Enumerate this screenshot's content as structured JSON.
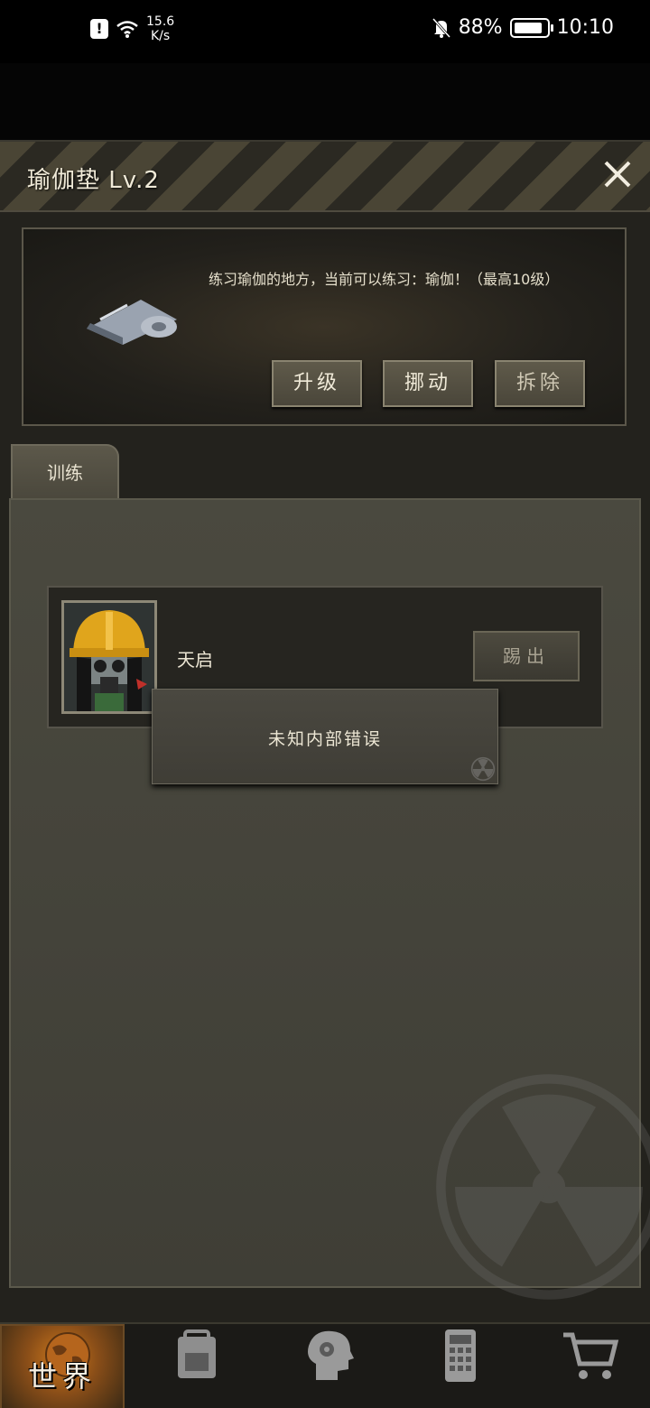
{
  "status_bar": {
    "network_speed_value": "15.6",
    "network_speed_unit": "K/s",
    "battery": "88%",
    "time": "10:10"
  },
  "dialog": {
    "title": "瑜伽垫 Lv.2",
    "description": "练习瑜伽的地方，当前可以练习：瑜伽！（最高10级）",
    "buttons": {
      "upgrade": "升级",
      "move": "挪动",
      "remove": "拆除"
    }
  },
  "tabs": [
    {
      "label": "训练",
      "selected": true
    }
  ],
  "members": [
    {
      "name": "天启",
      "kick_label": "踢出"
    }
  ],
  "toast": {
    "message": "未知内部错误"
  },
  "bottom_nav": [
    {
      "label": "世界",
      "icon": "globe-icon",
      "selected": true
    },
    {
      "label": "",
      "icon": "backpack-icon",
      "selected": false
    },
    {
      "label": "",
      "icon": "head-gear-icon",
      "selected": false
    },
    {
      "label": "",
      "icon": "phone-icon",
      "selected": false
    },
    {
      "label": "",
      "icon": "cart-icon",
      "selected": false
    }
  ],
  "colors": {
    "panel_bg": "#23221d",
    "content_bg": "#4a493f",
    "accent_orange": "#d07a1c",
    "text": "#e8e2d0"
  }
}
